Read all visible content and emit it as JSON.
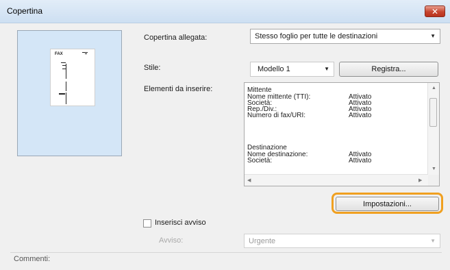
{
  "window": {
    "title": "Copertina"
  },
  "preview": {
    "page_label": "FAX"
  },
  "fields": {
    "cover_attached_label": "Copertina allegata:",
    "cover_attached_value": "Stesso foglio per tutte le destinazioni",
    "style_label": "Stile:",
    "style_value": "Modello 1",
    "register_button": "Registra...",
    "elements_label": "Elementi da inserire:"
  },
  "elements_list": [
    {
      "name": "Mittente",
      "value": ""
    },
    {
      "name": "Nome mittente (TTI):",
      "value": "Attivato"
    },
    {
      "name": "Società:",
      "value": "Attivato"
    },
    {
      "name": "Rep./Div.:",
      "value": "Attivato"
    },
    {
      "name": "Numero di fax/URI:",
      "value": "Attivato"
    },
    {
      "name": "",
      "value": ""
    },
    {
      "name": "Destinazione",
      "value": ""
    },
    {
      "name": "Nome destinazione:",
      "value": "Attivato"
    },
    {
      "name": "Società:",
      "value": "Attivato"
    }
  ],
  "settings_button": "Impostazioni...",
  "notice": {
    "checkbox_label": "Inserisci avviso",
    "checked": false,
    "field_label": "Avviso:",
    "field_value": "Urgente"
  },
  "comments_label": "Commenti:",
  "accent_color": "#f0a020"
}
